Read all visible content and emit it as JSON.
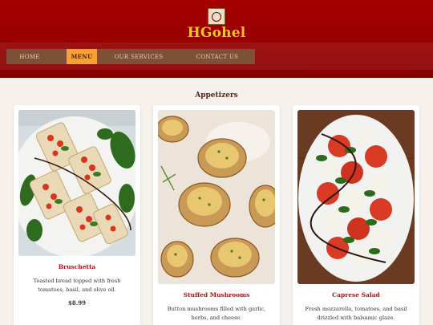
{
  "header": {
    "brand": "HGohel"
  },
  "nav": {
    "items": [
      {
        "label": "HOME"
      },
      {
        "label": "MENU"
      },
      {
        "label": "OUR SERVICES"
      },
      {
        "label": "CONTACT US"
      }
    ]
  },
  "section": {
    "title": "Appetizers"
  },
  "cards": [
    {
      "name": "Bruschetta",
      "desc": "Toasted bread topped with fresh tomatoes, basil, and olive oil.",
      "price": "$8.99"
    },
    {
      "name": "Stuffed Mushrooms",
      "desc": "Button mushrooms filled with garlic, herbs, and cheese."
    },
    {
      "name": "Caprese Salad",
      "desc": "Fresh mozzarella, tomatoes, and basil drizzled with balsamic glaze."
    }
  ],
  "colors": {
    "header": "#960000",
    "brand": "#f5c42c",
    "nav_bg": "#7e5038",
    "nav_active": "#f3a233",
    "dish_name": "#b01010"
  }
}
